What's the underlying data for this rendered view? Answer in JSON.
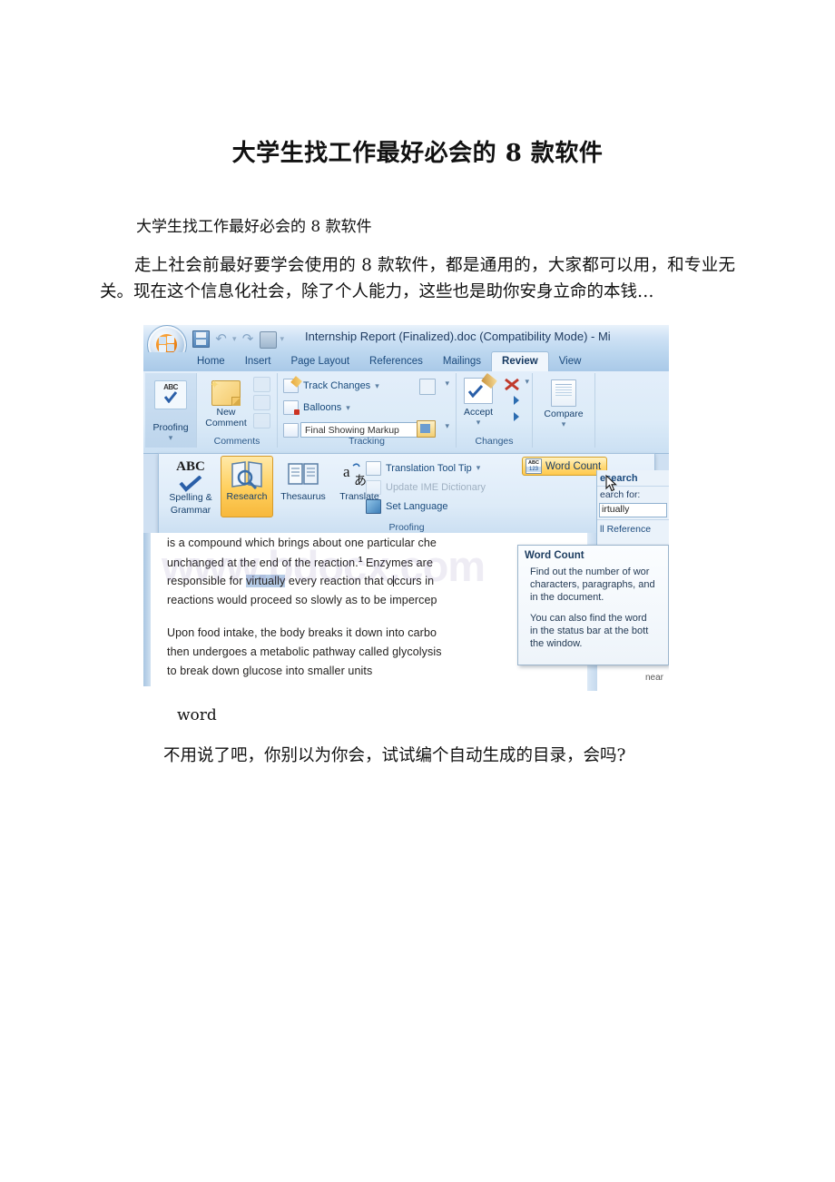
{
  "article": {
    "title": "大学生找工作最好必会的 8 款软件",
    "subtitle": "大学生找工作最好必会的 8 款软件",
    "paragraph1": "走上社会前最好要学会使用的 8 款软件，都是通用的，大家都可以用，和专业无关。现在这个信息化社会，除了个人能力，这些也是助你安身立命的本钱…",
    "caption": "word",
    "paragraph2": "不用说了吧，你别以为你会，试试编个自动生成的目录，会吗?"
  },
  "screenshot": {
    "watermark": "www.bdocx.com",
    "titlebar": {
      "document_title": "Internship Report (Finalized).doc (Compatibility Mode) - Mi",
      "office_button": "Office Button",
      "quick_access": [
        "Save",
        "Undo",
        "Redo",
        "Quick Print",
        "Customize Quick Access Toolbar"
      ]
    },
    "tabs": [
      {
        "label": "Home",
        "active": false
      },
      {
        "label": "Insert",
        "active": false
      },
      {
        "label": "Page Layout",
        "active": false
      },
      {
        "label": "References",
        "active": false
      },
      {
        "label": "Mailings",
        "active": false
      },
      {
        "label": "Review",
        "active": true
      },
      {
        "label": "View",
        "active": false
      }
    ],
    "ribbon": {
      "groups": [
        {
          "name": "Proofing",
          "label": "Proofing"
        },
        {
          "name": "Comments",
          "label": "Comments"
        },
        {
          "name": "Tracking",
          "label": "Tracking"
        },
        {
          "name": "Changes",
          "label": "Changes"
        },
        {
          "name": "Compare",
          "label": "Compare"
        },
        {
          "name": "Protect",
          "label": ""
        }
      ],
      "proofing_btn": "Proofing",
      "new_comment": "New",
      "new_comment2": "Comment",
      "track_changes": "Track Changes",
      "balloons": "Balloons",
      "display_for_review": "Final Showing Markup",
      "accept": "Accept",
      "compare": "Compare"
    },
    "proofing_gallery": {
      "group_label": "Proofing",
      "items": [
        {
          "label1": "Spelling &",
          "label2": "Grammar",
          "icon": "ABC"
        },
        {
          "label1": "Research",
          "label2": "",
          "icon": "book-magnifier",
          "selected": true
        },
        {
          "label1": "Thesaurus",
          "label2": "",
          "icon": "open-book"
        },
        {
          "label1": "Translate",
          "label2": "",
          "icon": "a-japanese"
        }
      ],
      "list": [
        {
          "label": "Translation Tool Tip",
          "disabled": false,
          "has_caret": true
        },
        {
          "label": "Update IME Dictionary",
          "disabled": true,
          "has_caret": false
        },
        {
          "label": "Set Language",
          "disabled": false,
          "has_caret": false
        }
      ],
      "word_count": "Word Count"
    },
    "document_lines": [
      "is a compound which brings about one particular che",
      "unchanged at the end of the reaction.",
      " Enzymes are",
      "responsible for ",
      "virtually",
      " every reaction that o",
      "ccurs in",
      "reactions would proceed so slowly as to be impercep",
      "Upon food intake, the body breaks it down into carbo",
      "then undergoes a metabolic pathway called glycolysis",
      "to break down glucose into smaller units",
      "1"
    ],
    "research_pane": {
      "title": "esearch",
      "search_label": "earch for:",
      "search_value": "irtually",
      "scope": "ll Reference",
      "near_text": "near"
    },
    "tooltip": {
      "title": "Word Count",
      "body1": "Find out the number of wor",
      "body2": "characters, paragraphs, and",
      "body3": "in the document.",
      "body4": "You can also find the word",
      "body5": "in the status bar at the bott",
      "body6": "the window."
    }
  }
}
